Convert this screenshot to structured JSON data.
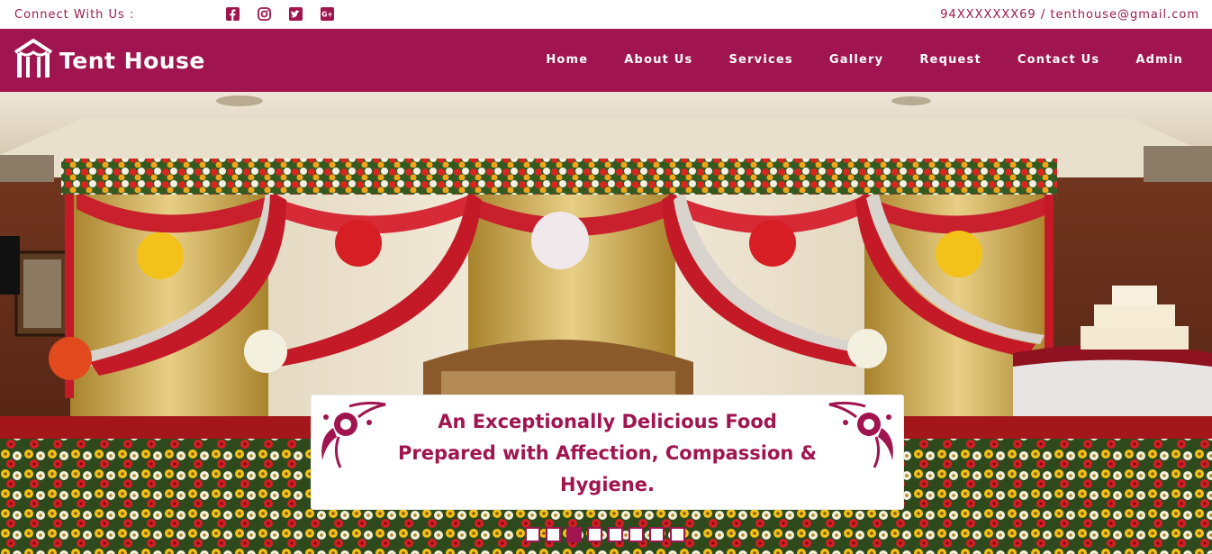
{
  "topbar": {
    "connect_label": "Connect With Us :",
    "social": [
      "facebook-icon",
      "instagram-icon",
      "twitter-icon",
      "google-plus-icon"
    ],
    "contact_text": "94XXXXXXX69 / tenthouse@gmail.com"
  },
  "header": {
    "brand_name": "Tent House",
    "nav": [
      {
        "label": "Home"
      },
      {
        "label": "About Us"
      },
      {
        "label": "Services"
      },
      {
        "label": "Gallery"
      },
      {
        "label": "Request"
      },
      {
        "label": "Contact Us"
      },
      {
        "label": "Admin"
      }
    ]
  },
  "hero": {
    "caption_lines": [
      "An Exceptionally Delicious Food",
      "Prepared with Affection, Compassion &",
      "Hygiene."
    ],
    "slide_count": 8,
    "active_slide": 3
  },
  "colors": {
    "brand": "#a0154f",
    "text_on_brand": "#ffffff"
  }
}
